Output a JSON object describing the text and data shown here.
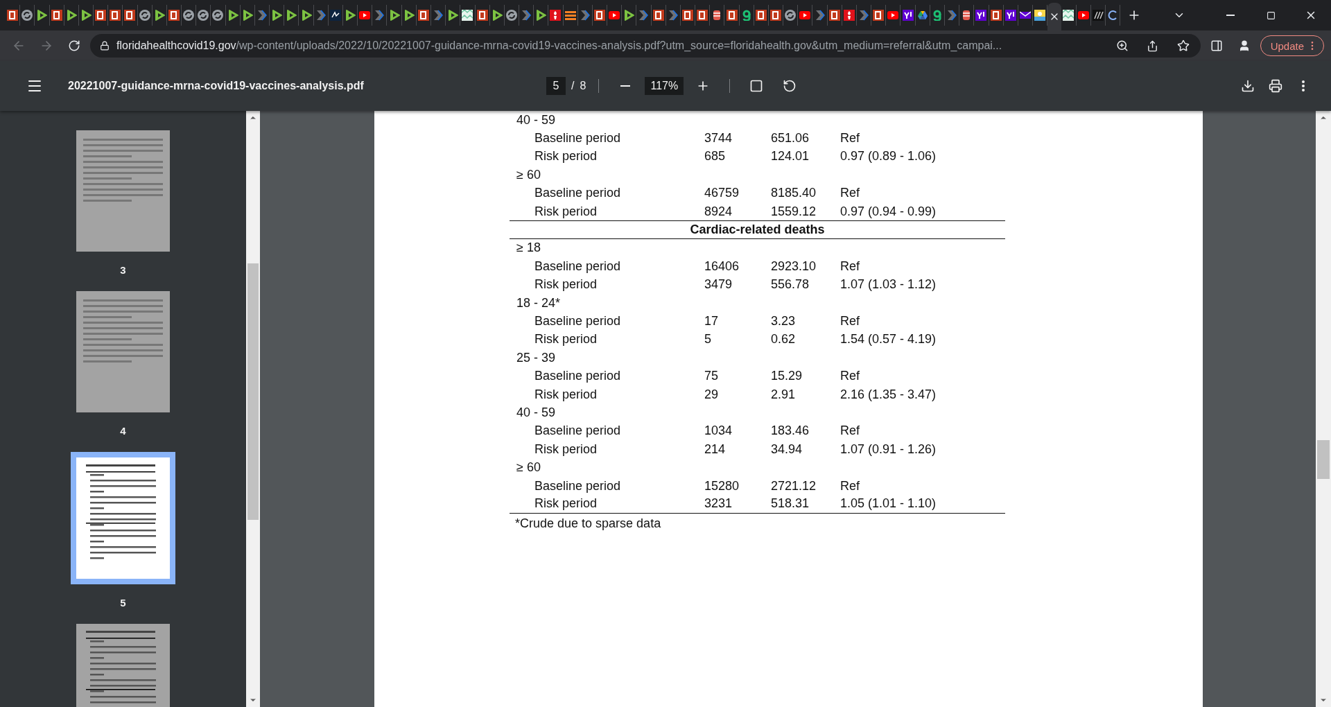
{
  "tabs": [
    {
      "kind": "b",
      "selected": false
    },
    {
      "kind": "sync",
      "selected": false
    },
    {
      "kind": "play",
      "selected": false
    },
    {
      "kind": "b",
      "selected": false
    },
    {
      "kind": "play",
      "selected": false
    },
    {
      "kind": "play",
      "selected": false
    },
    {
      "kind": "b",
      "selected": false
    },
    {
      "kind": "b",
      "selected": false
    },
    {
      "kind": "b",
      "selected": false
    },
    {
      "kind": "sync",
      "selected": false
    },
    {
      "kind": "play",
      "selected": false
    },
    {
      "kind": "b",
      "selected": false
    },
    {
      "kind": "sync",
      "selected": false
    },
    {
      "kind": "sync",
      "selected": false
    },
    {
      "kind": "sync",
      "selected": false
    },
    {
      "kind": "play",
      "selected": false
    },
    {
      "kind": "play",
      "selected": false
    },
    {
      "kind": "chevron",
      "selected": false
    },
    {
      "kind": "play",
      "selected": false
    },
    {
      "kind": "play",
      "selected": false
    },
    {
      "kind": "play",
      "selected": false
    },
    {
      "kind": "chevron",
      "selected": false
    },
    {
      "kind": "doc",
      "selected": false
    },
    {
      "kind": "play",
      "selected": false
    },
    {
      "kind": "youtube",
      "selected": false
    },
    {
      "kind": "chevron",
      "selected": false
    },
    {
      "kind": "play",
      "selected": false
    },
    {
      "kind": "play",
      "selected": false
    },
    {
      "kind": "b",
      "selected": false
    },
    {
      "kind": "chevron",
      "selected": false
    },
    {
      "kind": "play",
      "selected": false
    },
    {
      "kind": "grid",
      "selected": false
    },
    {
      "kind": "b",
      "selected": false
    },
    {
      "kind": "play",
      "selected": false
    },
    {
      "kind": "sync",
      "selected": false
    },
    {
      "kind": "chevron",
      "selected": false
    },
    {
      "kind": "play",
      "selected": false
    },
    {
      "kind": "torch",
      "selected": false
    },
    {
      "kind": "feed",
      "selected": false
    },
    {
      "kind": "chevron",
      "selected": false
    },
    {
      "kind": "b",
      "selected": false
    },
    {
      "kind": "youtube",
      "selected": false
    },
    {
      "kind": "play",
      "selected": false
    },
    {
      "kind": "chevron",
      "selected": false
    },
    {
      "kind": "b",
      "selected": false
    },
    {
      "kind": "chevron",
      "selected": false
    },
    {
      "kind": "b",
      "selected": false
    },
    {
      "kind": "b",
      "selected": false
    },
    {
      "kind": "jar",
      "selected": false
    },
    {
      "kind": "b",
      "selected": false
    },
    {
      "kind": "g",
      "selected": false
    },
    {
      "kind": "b",
      "selected": false
    },
    {
      "kind": "b",
      "selected": false
    },
    {
      "kind": "sync",
      "selected": false
    },
    {
      "kind": "youtube",
      "selected": false
    },
    {
      "kind": "chevron",
      "selected": false
    },
    {
      "kind": "b",
      "selected": false
    },
    {
      "kind": "torch",
      "selected": false
    },
    {
      "kind": "chevron",
      "selected": false
    },
    {
      "kind": "b",
      "selected": false
    },
    {
      "kind": "youtube",
      "selected": false
    },
    {
      "kind": "yahoo",
      "selected": false
    },
    {
      "kind": "drive",
      "selected": false
    },
    {
      "kind": "g",
      "selected": false
    },
    {
      "kind": "chevron",
      "selected": false
    },
    {
      "kind": "jar",
      "selected": false
    },
    {
      "kind": "yahoo",
      "selected": false
    },
    {
      "kind": "b",
      "selected": false
    },
    {
      "kind": "yahoo",
      "selected": false
    },
    {
      "kind": "mail",
      "selected": false
    },
    {
      "kind": "beach",
      "selected": false
    },
    {
      "selected": true
    },
    {
      "kind": "grid",
      "selected": false
    },
    {
      "kind": "youtube",
      "selected": false
    },
    {
      "kind": "dark",
      "selected": false
    },
    {
      "kind": "loader",
      "selected": false
    }
  ],
  "address_bar": {
    "host": "floridahealthcovid19.gov",
    "rest": "/wp-content/uploads/2022/10/20221007-guidance-mrna-covid19-vaccines-analysis.pdf?utm_source=floridahealth.gov&utm_medium=referral&utm_campai..."
  },
  "update_button": "Update",
  "pdf_toolbar": {
    "filename": "20221007-guidance-mrna-covid19-vaccines-analysis.pdf",
    "page": "5",
    "separator": "/",
    "page_count": "8",
    "zoom": "117%"
  },
  "thumbnails": [
    {
      "label": "3",
      "kind": "text",
      "selected": false
    },
    {
      "label": "4",
      "kind": "text",
      "selected": false
    },
    {
      "label": "5",
      "kind": "table",
      "selected": true
    },
    {
      "kind": "table",
      "selected": false
    }
  ],
  "table_rows": [
    {
      "kind": "group",
      "label": "40 - 59"
    },
    {
      "kind": "data",
      "label": "Baseline period",
      "column_2": "3744",
      "column_3": "651.06",
      "column_4": "Ref"
    },
    {
      "kind": "data",
      "label": "Risk period",
      "column_2": "685",
      "column_3": "124.01",
      "column_4": "0.97 (0.89 - 1.06)"
    },
    {
      "kind": "group",
      "label": "≥ 60"
    },
    {
      "kind": "data",
      "label": "Baseline period",
      "column_2": "46759",
      "column_3": "8185.40",
      "column_4": "Ref"
    },
    {
      "kind": "data",
      "label": "Risk period",
      "column_2": "8924",
      "column_3": "1559.12",
      "column_4": "0.97 (0.94 - 0.99)"
    },
    {
      "kind": "section",
      "label": "Cardiac-related deaths"
    },
    {
      "kind": "group",
      "label": "≥ 18"
    },
    {
      "kind": "data",
      "label": "Baseline period",
      "column_2": "16406",
      "column_3": "2923.10",
      "column_4": "Ref"
    },
    {
      "kind": "data",
      "label": "Risk period",
      "column_2": "3479",
      "column_3": "556.78",
      "column_4": "1.07 (1.03 - 1.12)"
    },
    {
      "kind": "group",
      "label": "18 - 24*"
    },
    {
      "kind": "data",
      "label": "Baseline period",
      "column_2": "17",
      "column_3": "3.23",
      "column_4": "Ref"
    },
    {
      "kind": "data",
      "label": "Risk period",
      "column_2": "5",
      "column_3": "0.62",
      "column_4": "1.54 (0.57 - 4.19)"
    },
    {
      "kind": "group",
      "label": "25 - 39"
    },
    {
      "kind": "data",
      "label": "Baseline period",
      "column_2": "75",
      "column_3": "15.29",
      "column_4": "Ref"
    },
    {
      "kind": "data",
      "label": "Risk period",
      "column_2": "29",
      "column_3": "2.91",
      "column_4": "2.16 (1.35 - 3.47)"
    },
    {
      "kind": "group",
      "label": "40 - 59"
    },
    {
      "kind": "data",
      "label": "Baseline period",
      "column_2": "1034",
      "column_3": "183.46",
      "column_4": "Ref"
    },
    {
      "kind": "data",
      "label": "Risk period",
      "column_2": "214",
      "column_3": "34.94",
      "column_4": "1.07 (0.91 - 1.26)"
    },
    {
      "kind": "group",
      "label": "≥ 60"
    },
    {
      "kind": "data",
      "label": "Baseline period",
      "column_2": "15280",
      "column_3": "2721.12",
      "column_4": "Ref"
    },
    {
      "kind": "data",
      "label": "Risk period",
      "column_2": "3231",
      "column_3": "518.31",
      "column_4": "1.05 (1.01 - 1.10)"
    }
  ],
  "footnote": "*Crude due to sparse data"
}
